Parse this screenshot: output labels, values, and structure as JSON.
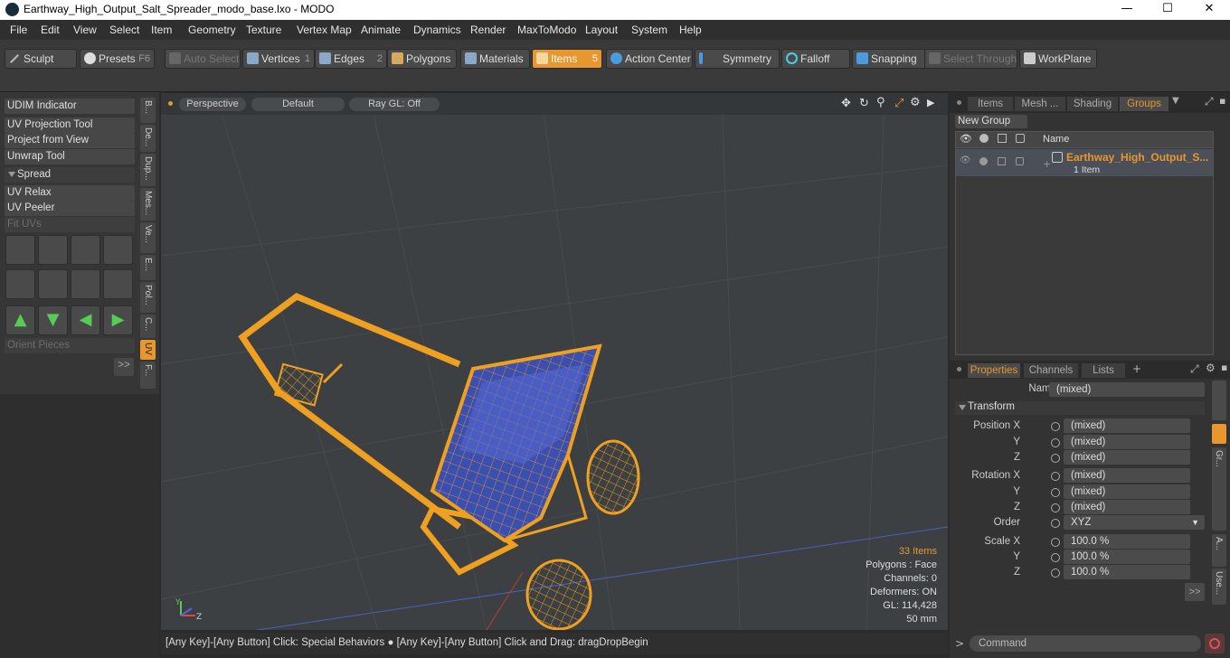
{
  "window": {
    "title": "Earthway_High_Output_Salt_Spreader_modo_base.lxo - MODO",
    "minimize": "—",
    "maximize": "☐",
    "close": "✕"
  },
  "menu": [
    "File",
    "Edit",
    "View",
    "Select",
    "Item",
    "Geometry",
    "Texture",
    "Vertex Map",
    "Animate",
    "Dynamics",
    "Render",
    "MaxToModo",
    "Layout",
    "System",
    "Help"
  ],
  "toolbar": {
    "sculpt": "Sculpt",
    "presets": "Presets",
    "presets_key": "F6",
    "auto_select": "Auto Select",
    "vertices": "Vertices",
    "vertices_key": "1",
    "edges": "Edges",
    "edges_key": "2",
    "polygons": "Polygons",
    "materials": "Materials",
    "items": "Items",
    "items_key": "5",
    "action_center": "Action Center",
    "symmetry": "Symmetry",
    "falloff": "Falloff",
    "snapping": "Snapping",
    "select_through": "Select Through",
    "workplane": "WorkPlane"
  },
  "left": {
    "tools": [
      "UDIM Indicator",
      "UV Projection Tool",
      "Project from View",
      "Unwrap Tool"
    ],
    "spread": "Spread",
    "tools2": [
      "UV Relax",
      "UV Peeler"
    ],
    "fit_uvs": "Fit UVs",
    "orient": "Orient Pieces",
    "more": ">>",
    "vtabs": [
      "B...",
      "De...",
      "Dup...",
      "Mes...",
      "Ve...",
      "E...",
      "Pol...",
      "C...",
      "UV",
      "F..."
    ]
  },
  "viewport": {
    "perspective": "Perspective",
    "default": "Default",
    "raygl": "Ray GL: Off",
    "stats": {
      "items": "33 Items",
      "polygons": "Polygons : Face",
      "channels": "Channels: 0",
      "deformers": "Deformers: ON",
      "gl": "GL: 114,428",
      "unit": "50 mm"
    }
  },
  "status": "[Any Key]-[Any Button] Click: Special Behaviors ● [Any Key]-[Any Button] Click and Drag: dragDropBegin",
  "right": {
    "tabs": [
      "Items",
      "Mesh ...",
      "Shading",
      "Groups"
    ],
    "new_group": "New Group",
    "col_name": "Name",
    "group_name": "Earthway_High_Output_S...",
    "group_count": "1 Item",
    "ptabs": [
      "Properties",
      "Channels",
      "Lists",
      "+"
    ],
    "name_label": "Name",
    "name_value": "(mixed)",
    "transform": "Transform",
    "position_label": "Position X",
    "rotation_label": "Rotation X",
    "y": "Y",
    "z": "Z",
    "mixed": "(mixed)",
    "order_label": "Order",
    "order_value": "XYZ",
    "scale_label": "Scale X",
    "scale_value": "100.0 %",
    "side_tabs": [
      "Gr...",
      "A...",
      "Use..."
    ],
    "command": "Command"
  },
  "colors": {
    "accent": "#e8962e",
    "wire": "#f0a020",
    "surface": "#3b4fb0"
  }
}
